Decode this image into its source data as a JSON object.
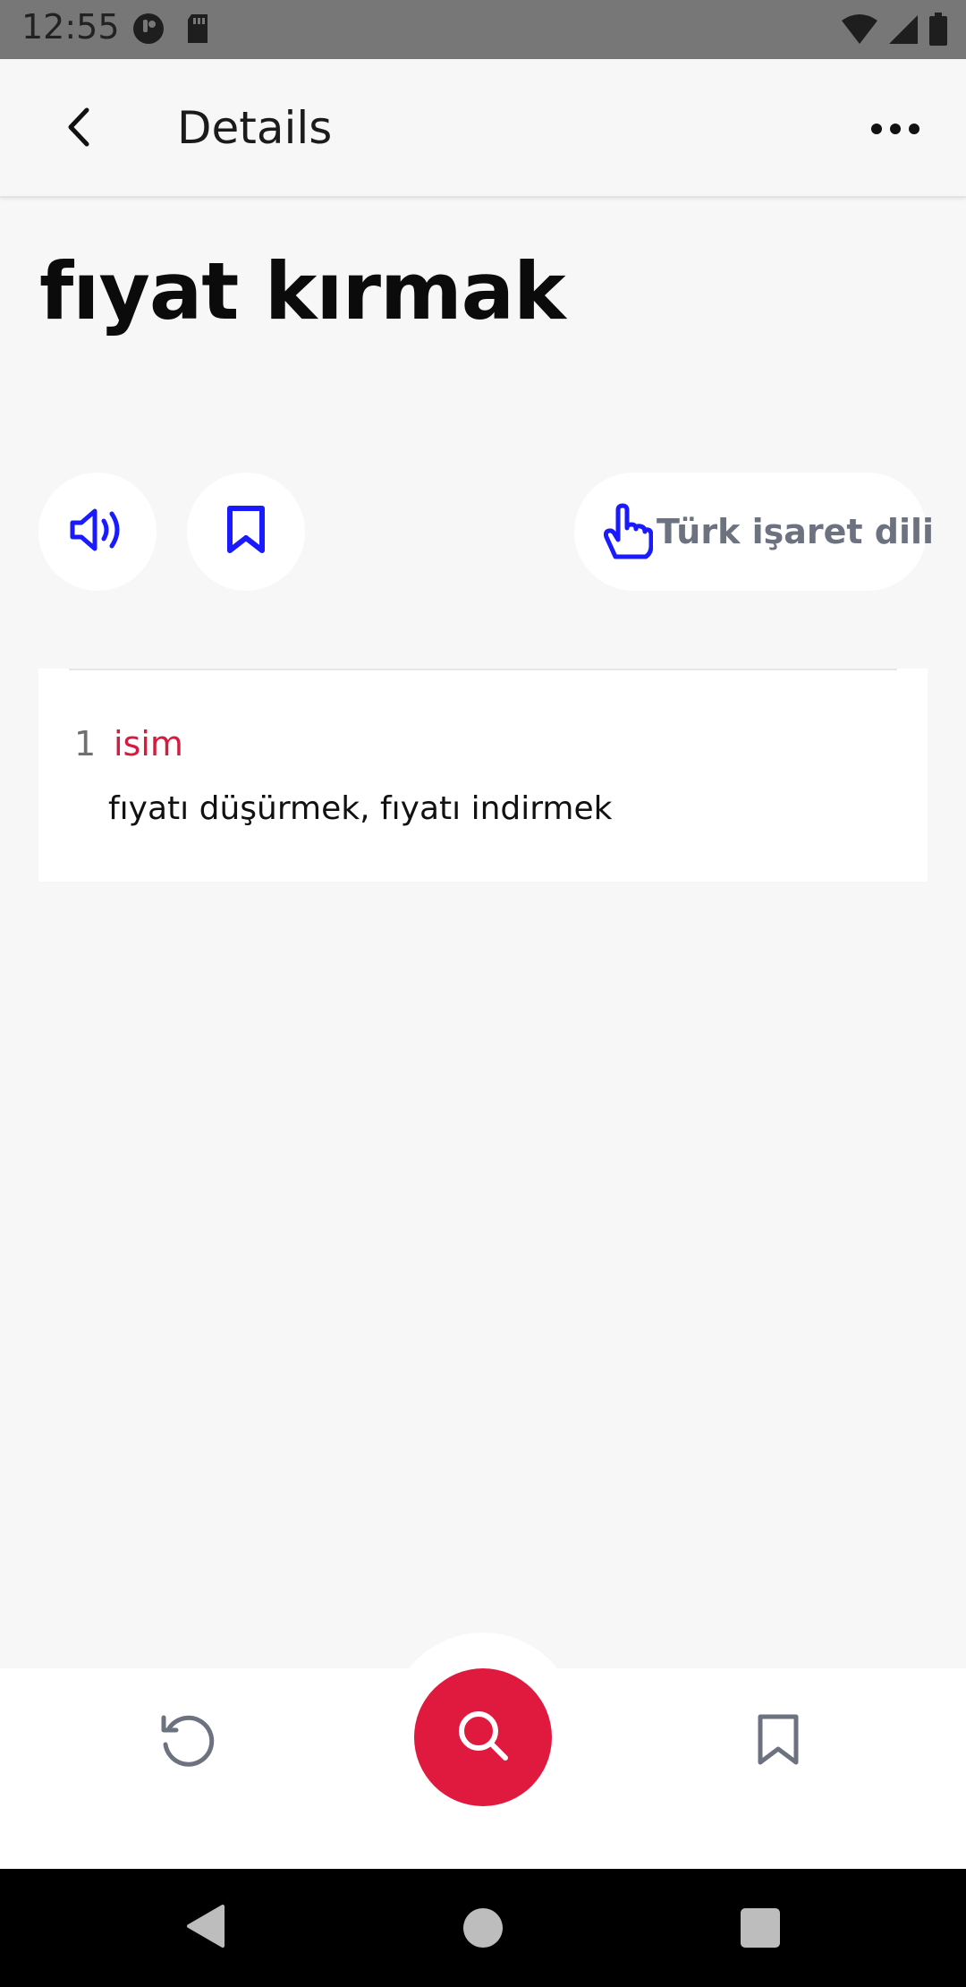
{
  "status_bar": {
    "time": "12:55",
    "icons": [
      "notification-app-icon",
      "sd-card-icon",
      "wifi-icon",
      "signal-icon",
      "battery-icon"
    ]
  },
  "app_bar": {
    "title": "Details",
    "back_icon": "chevron-left-icon",
    "more_icon": "more-horizontal-icon"
  },
  "word": {
    "title": "fıyat kırmak"
  },
  "actions": {
    "sound_icon": "speaker-icon",
    "bookmark_icon": "bookmark-icon",
    "sign_language_label": "Türk işaret dili",
    "sign_language_icon": "pointing-hand-icon"
  },
  "definitions": [
    {
      "number": "1",
      "part_of_speech": "isim",
      "text": "fıyatı düşürmek, fıyatı indirmek"
    }
  ],
  "bottom_nav": {
    "history_icon": "history-icon",
    "search_icon": "search-icon",
    "saved_icon": "bookmark-icon"
  },
  "colors": {
    "accent_red": "#e0193f",
    "icon_blue": "#1a1aff",
    "pos_red": "#d51b3e",
    "label_gray": "#6c7280",
    "background": "#f7f7f7"
  }
}
